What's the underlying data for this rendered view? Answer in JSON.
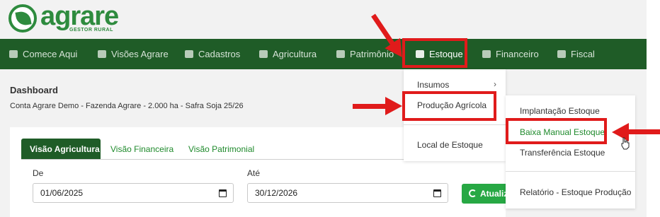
{
  "logo": {
    "name": "agrare",
    "subtitle": "GESTOR RURAL"
  },
  "navbar": {
    "items": [
      {
        "label": "Comece Aqui",
        "icon": "users-icon"
      },
      {
        "label": "Visões Agrare",
        "icon": "grid-icon"
      },
      {
        "label": "Cadastros",
        "icon": "tag-icon"
      },
      {
        "label": "Agricultura",
        "icon": "leaf-icon"
      },
      {
        "label": "Patrimônio",
        "icon": "tractor-icon"
      },
      {
        "label": "Estoque",
        "icon": "boxes-icon"
      },
      {
        "label": "Financeiro",
        "icon": "hand-money-icon"
      },
      {
        "label": "Fiscal",
        "icon": "document-icon"
      }
    ],
    "active": "Estoque"
  },
  "dashboard": {
    "title": "Dashboard",
    "subtitle": "Conta Agrare Demo - Fazenda Agrare - 2.000 ha - Safra Soja 25/26"
  },
  "tabs": [
    "Visão Agricultura",
    "Visão Financeira",
    "Visão Patrimonial"
  ],
  "filters": {
    "from_label": "De",
    "from_value": "01/06/2025",
    "to_label": "Até",
    "to_value": "30/12/2026",
    "refresh_label": "Atualizar"
  },
  "estoque_menu": {
    "items": [
      "Insumos",
      "Produção Agrícola",
      "Local de Estoque"
    ],
    "chevron": "›"
  },
  "producao_submenu": {
    "items": [
      "Implantação Estoque",
      "Baixa Manual Estoque",
      "Transferência Estoque",
      "Relatório - Estoque Produção"
    ],
    "highlighted": "Baixa Manual Estoque"
  },
  "colors": {
    "nav_bg": "#1f5c27",
    "brand_green": "#2e8b3e",
    "annotation_red": "#e01b1b",
    "refresh_button": "#27a844"
  }
}
